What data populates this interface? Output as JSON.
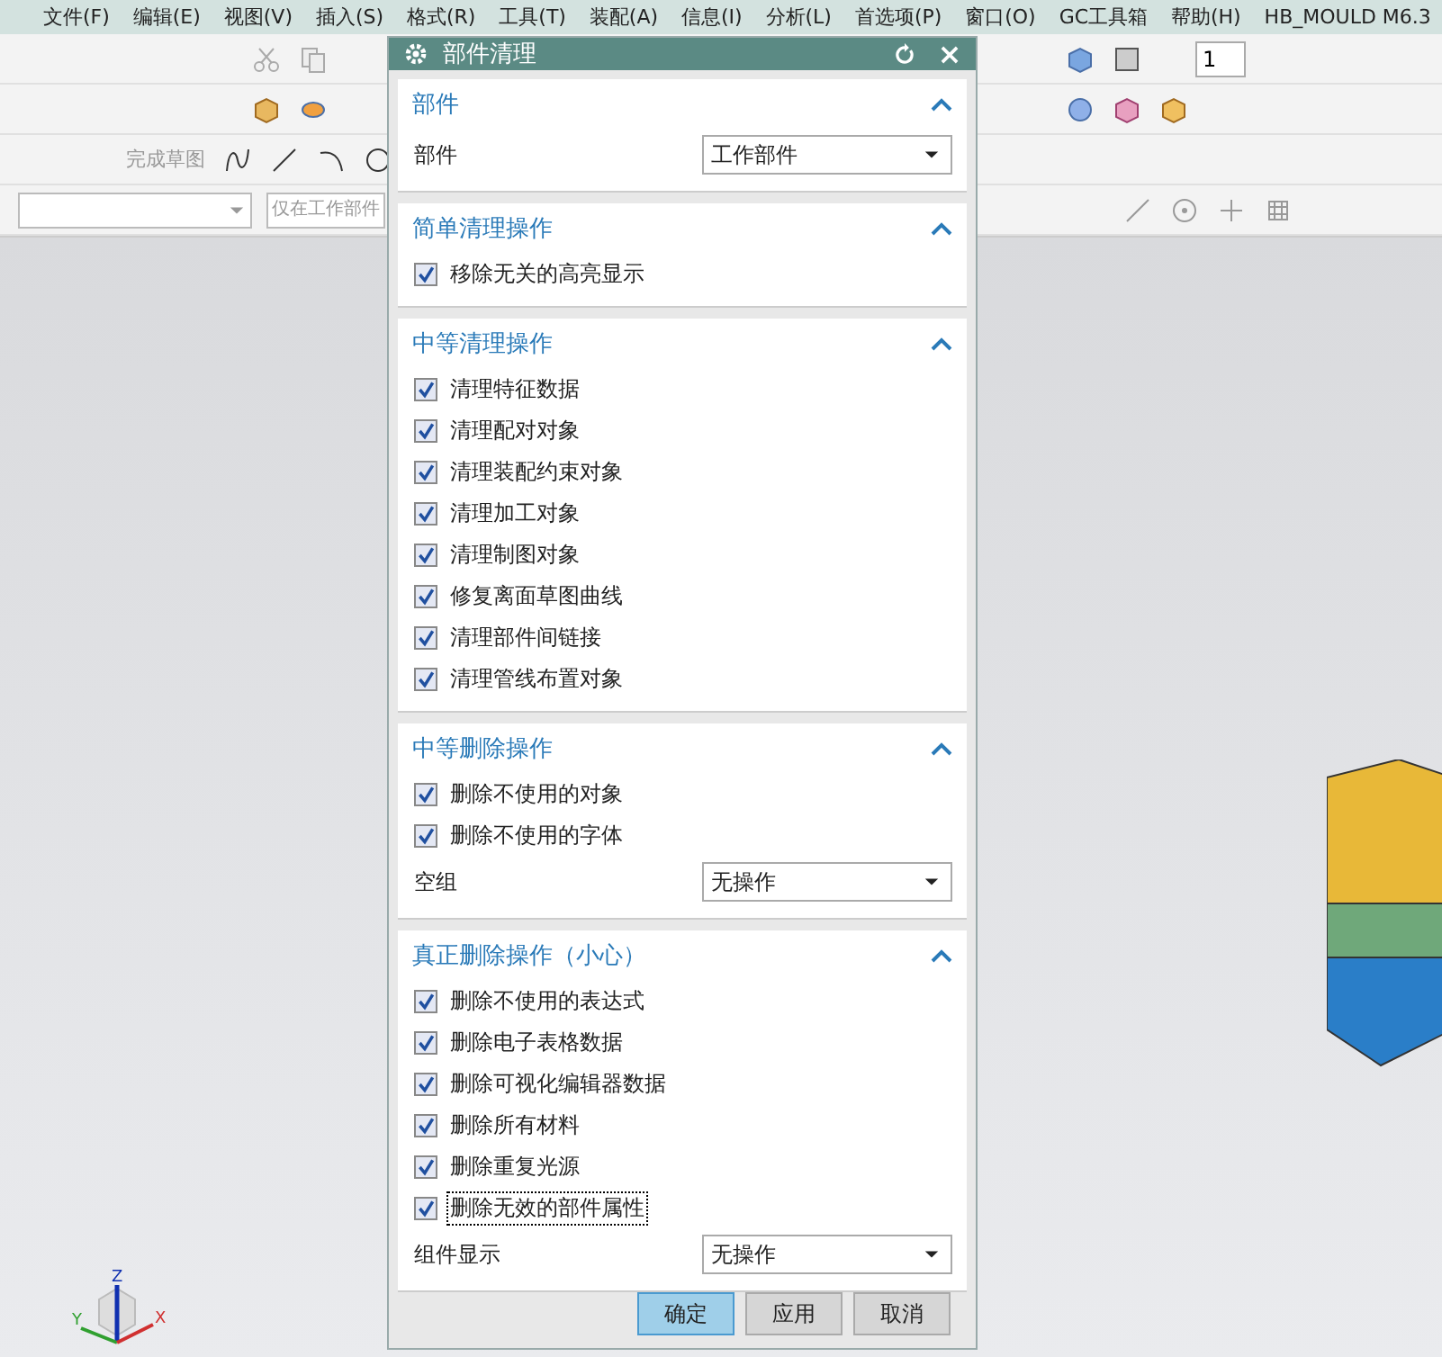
{
  "menu_bar": [
    "文件(F)",
    "编辑(E)",
    "视图(V)",
    "插入(S)",
    "格式(R)",
    "工具(T)",
    "装配(A)",
    "信息(I)",
    "分析(L)",
    "首选项(P)",
    "窗口(O)",
    "GC工具箱",
    "帮助(H)",
    "HB_MOULD M6.3"
  ],
  "toolbar": {
    "finish_sketch": "完成草图",
    "filter_combo": "仅在工作部件",
    "layer_field": "1"
  },
  "view_triad": {
    "z_label": "Z",
    "y_label": "Y",
    "x_label": "X"
  },
  "dialog": {
    "title": "部件清理",
    "sections": [
      {
        "title": "部件",
        "expanded": true,
        "items": [
          {
            "kind": "dropdown",
            "label": "部件",
            "value": "工作部件"
          }
        ]
      },
      {
        "title": "简单清理操作",
        "expanded": true,
        "items": [
          {
            "kind": "checkbox",
            "label": "移除无关的高亮显示",
            "checked": true,
            "focused": false
          }
        ]
      },
      {
        "title": "中等清理操作",
        "expanded": true,
        "items": [
          {
            "kind": "checkbox",
            "label": "清理特征数据",
            "checked": true,
            "focused": false
          },
          {
            "kind": "checkbox",
            "label": "清理配对对象",
            "checked": true,
            "focused": false
          },
          {
            "kind": "checkbox",
            "label": "清理装配约束对象",
            "checked": true,
            "focused": false
          },
          {
            "kind": "checkbox",
            "label": "清理加工对象",
            "checked": true,
            "focused": false
          },
          {
            "kind": "checkbox",
            "label": "清理制图对象",
            "checked": true,
            "focused": false
          },
          {
            "kind": "checkbox",
            "label": "修复离面草图曲线",
            "checked": true,
            "focused": false
          },
          {
            "kind": "checkbox",
            "label": "清理部件间链接",
            "checked": true,
            "focused": false
          },
          {
            "kind": "checkbox",
            "label": "清理管线布置对象",
            "checked": true,
            "focused": false
          }
        ]
      },
      {
        "title": "中等删除操作",
        "expanded": true,
        "items": [
          {
            "kind": "checkbox",
            "label": "删除不使用的对象",
            "checked": true,
            "focused": false
          },
          {
            "kind": "checkbox",
            "label": "删除不使用的字体",
            "checked": true,
            "focused": false
          },
          {
            "kind": "dropdown",
            "label": "空组",
            "value": "无操作"
          }
        ]
      },
      {
        "title": "真正删除操作（小心）",
        "expanded": true,
        "items": [
          {
            "kind": "checkbox",
            "label": "删除不使用的表达式",
            "checked": true,
            "focused": false
          },
          {
            "kind": "checkbox",
            "label": "删除电子表格数据",
            "checked": true,
            "focused": false
          },
          {
            "kind": "checkbox",
            "label": "删除可视化编辑器数据",
            "checked": true,
            "focused": false
          },
          {
            "kind": "checkbox",
            "label": "删除所有材料",
            "checked": true,
            "focused": false
          },
          {
            "kind": "checkbox",
            "label": "删除重复光源",
            "checked": true,
            "focused": false
          },
          {
            "kind": "checkbox",
            "label": "删除无效的部件属性",
            "checked": true,
            "focused": true
          },
          {
            "kind": "dropdown",
            "label": "组件显示",
            "value": "无操作"
          }
        ]
      }
    ],
    "buttons": [
      {
        "label": "确定",
        "default": true
      },
      {
        "label": "应用",
        "default": false
      },
      {
        "label": "取消",
        "default": false
      }
    ]
  }
}
